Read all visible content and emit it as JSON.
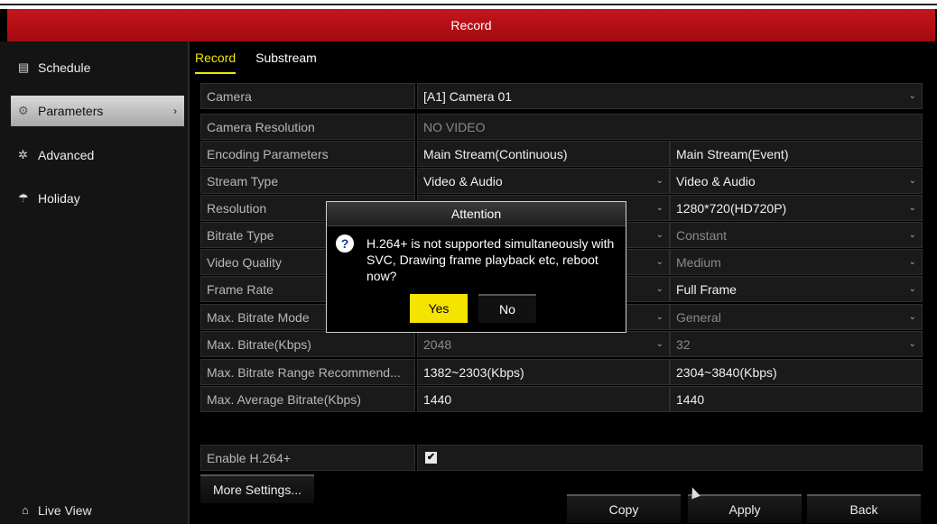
{
  "window": {
    "title": "Record"
  },
  "sidebar": {
    "items": [
      {
        "label": "Schedule",
        "icon": "calendar-icon"
      },
      {
        "label": "Parameters",
        "icon": "gear-icon",
        "active": true
      },
      {
        "label": "Advanced",
        "icon": "advanced-gear-icon"
      },
      {
        "label": "Holiday",
        "icon": "umbrella-icon"
      }
    ],
    "live_view": "Live View"
  },
  "tabs": [
    {
      "label": "Record",
      "active": true
    },
    {
      "label": "Substream",
      "active": false
    }
  ],
  "rows": [
    {
      "label": "Camera",
      "value": "[A1] Camera 01",
      "dropdown": true
    },
    {
      "label": "Camera Resolution",
      "value": "NO VIDEO"
    },
    {
      "label": "Encoding Parameters",
      "main": "Main Stream(Continuous)",
      "event": "Main Stream(Event)"
    },
    {
      "label": "Stream Type",
      "main": "Video & Audio",
      "event": "Video & Audio"
    },
    {
      "label": "Resolution",
      "main": "",
      "event": "1280*720(HD720P)"
    },
    {
      "label": "Bitrate Type",
      "main": "",
      "event": "Constant"
    },
    {
      "label": "Video Quality",
      "main": "",
      "event": "Medium"
    },
    {
      "label": "Frame Rate",
      "main": "",
      "event": "Full Frame"
    },
    {
      "label": "Max. Bitrate Mode",
      "main": "",
      "event": "General"
    },
    {
      "label": "Max. Bitrate(Kbps)",
      "main": "2048",
      "event": "32"
    },
    {
      "label": "Max. Bitrate Range Recommend...",
      "main": "1382~2303(Kbps)",
      "event": "2304~3840(Kbps)"
    },
    {
      "label": "Max. Average Bitrate(Kbps)",
      "main": "1440",
      "event": "1440"
    }
  ],
  "enable_h264": {
    "label": "Enable H.264+",
    "checked": true,
    "check_glyph": "✔"
  },
  "buttons": {
    "more_settings": "More Settings...",
    "copy": "Copy",
    "apply": "Apply",
    "back": "Back"
  },
  "dialog": {
    "title": "Attention",
    "message": "H.264+ is not supported simultaneously with SVC, Drawing frame playback etc, reboot now?",
    "yes": "Yes",
    "no": "No"
  },
  "colors": {
    "title_bar": "#b81018",
    "accent": "#f2e600",
    "yes_button": "#f5e400"
  }
}
